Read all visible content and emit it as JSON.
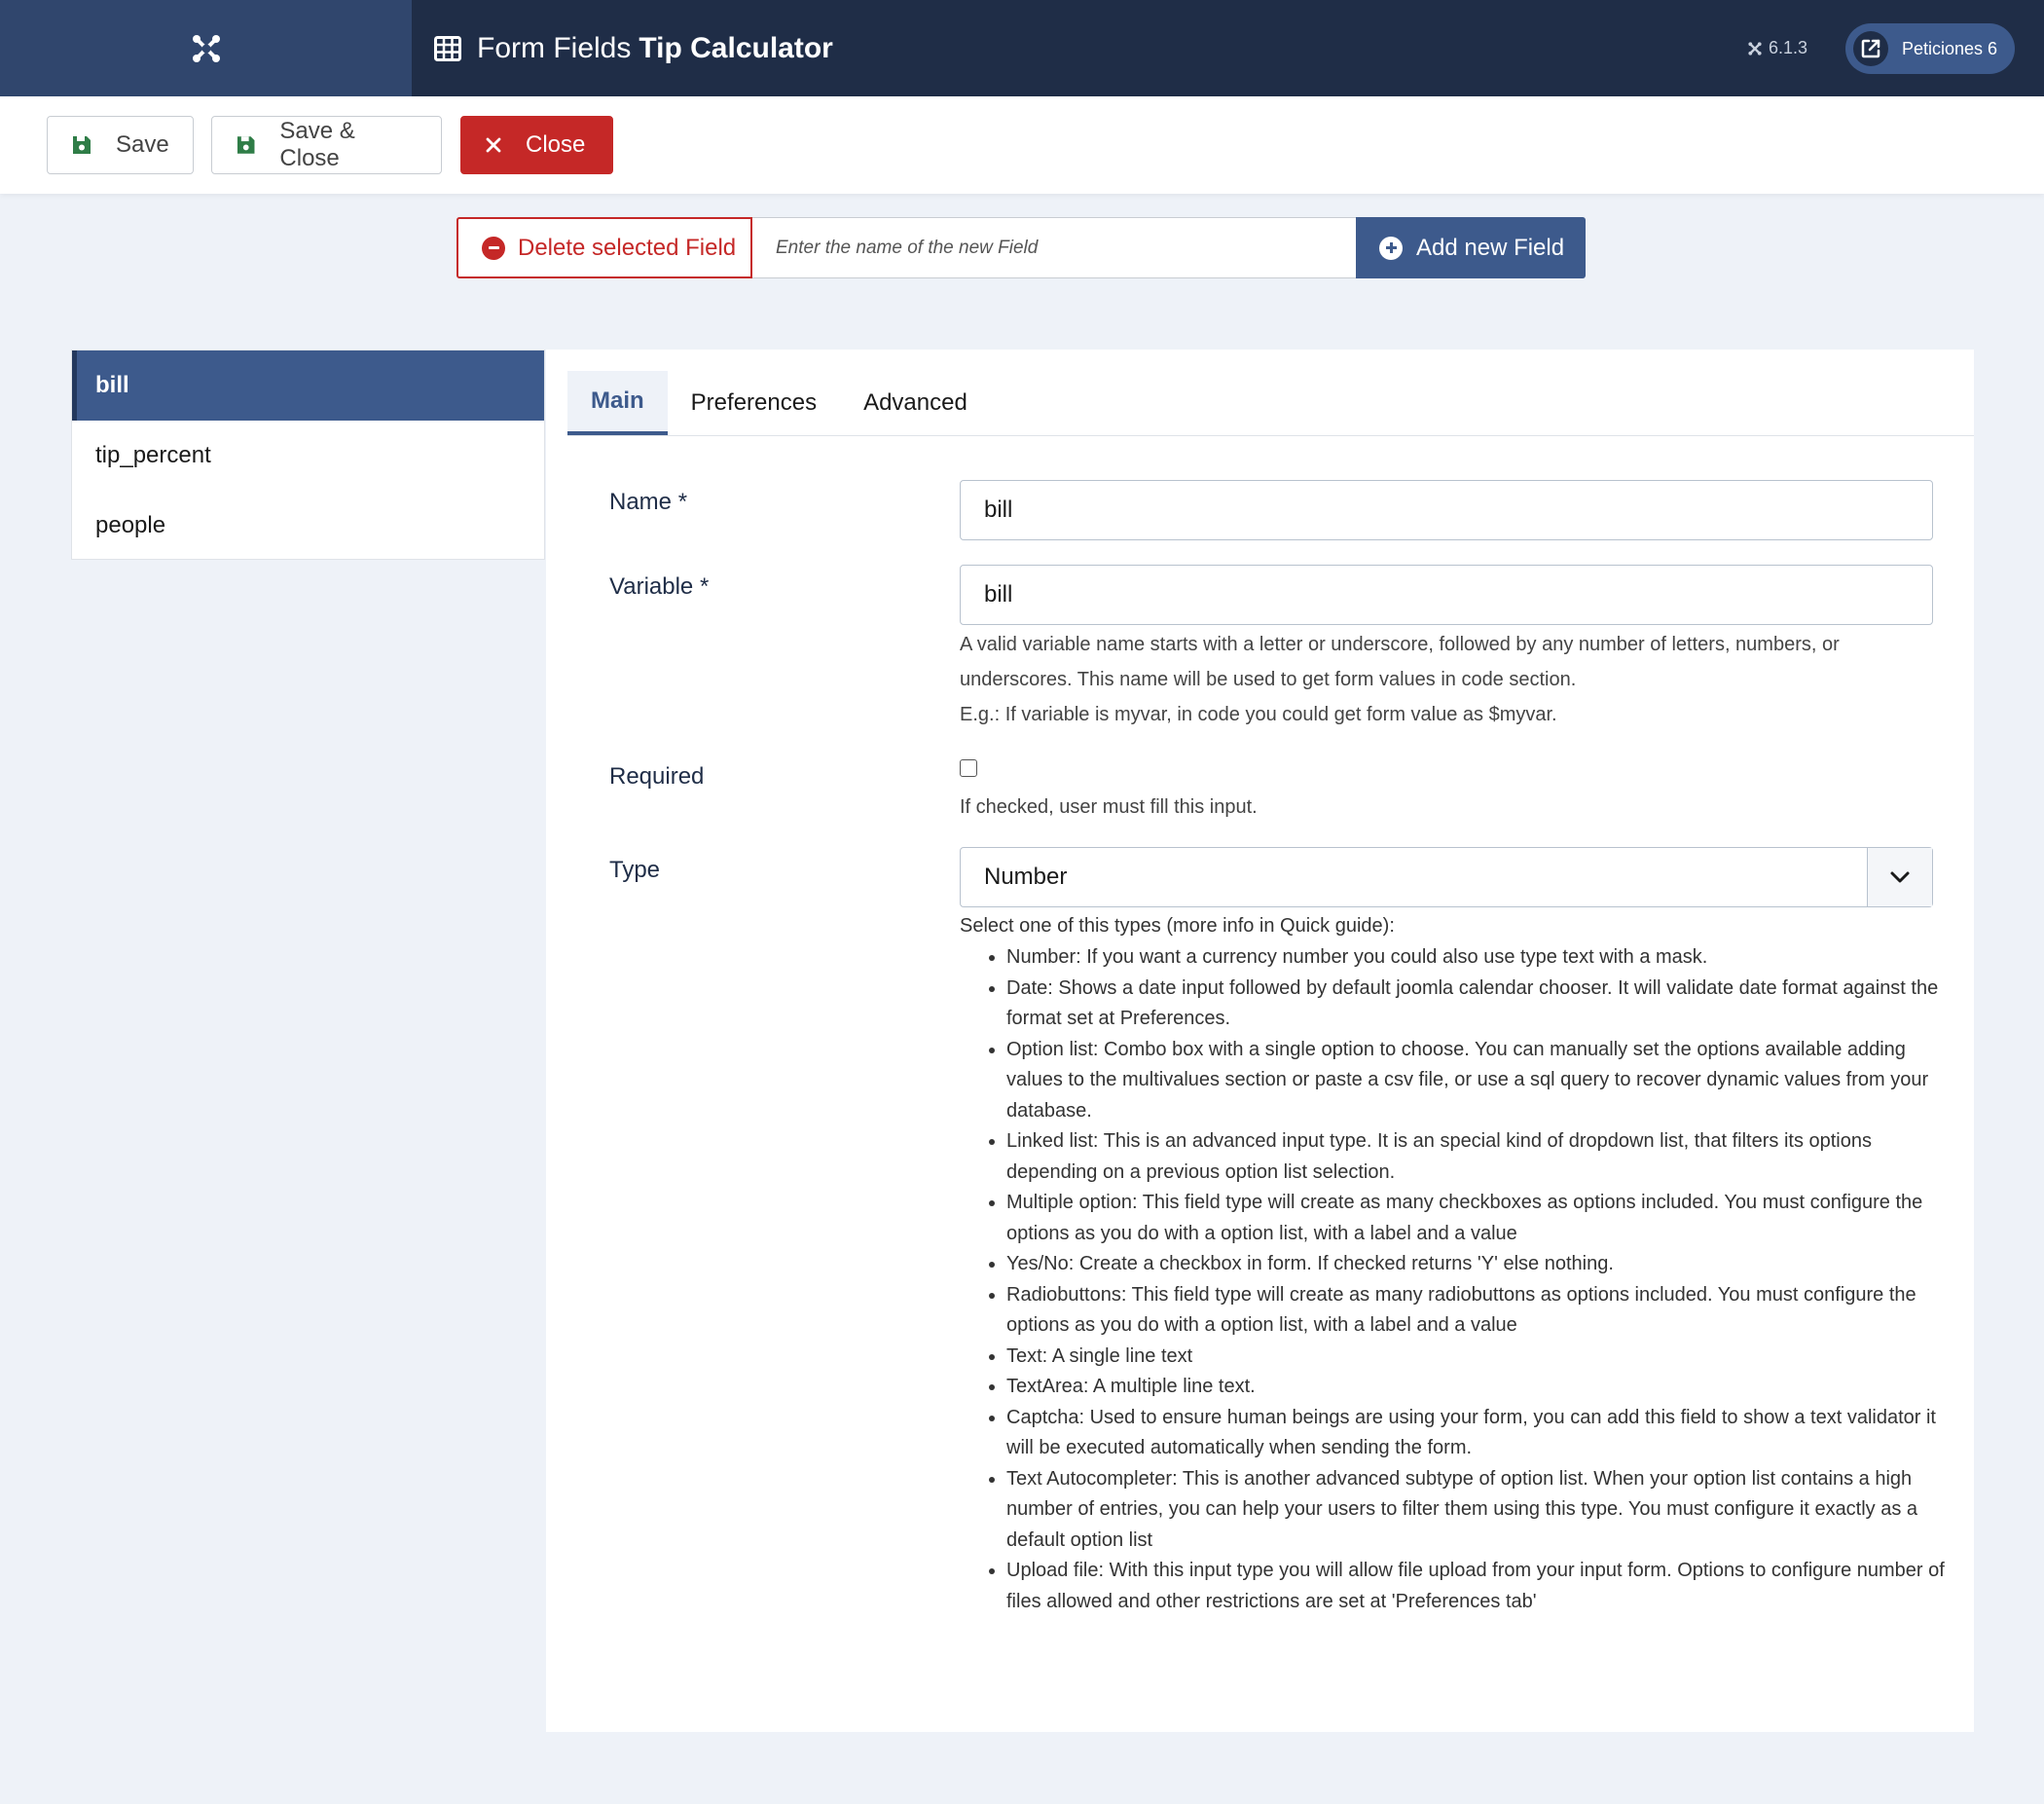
{
  "header": {
    "title_prefix": "Form Fields",
    "title_bold": "Tip Calculator",
    "version": "6.1.3",
    "requests_label": "Peticiones 6",
    "colors": {
      "header_bg": "#1f2d47",
      "logo_bg": "#30466d",
      "accent": "#3d5a8c",
      "danger": "#c52827"
    }
  },
  "toolbar": {
    "save_label": "Save",
    "save_close_label": "Save & Close",
    "close_label": "Close"
  },
  "field_actions": {
    "delete_label": "Delete selected Field",
    "new_field_placeholder": "Enter the name of the new Field",
    "add_label": "Add new Field"
  },
  "fields": [
    {
      "label": "bill",
      "active": true
    },
    {
      "label": "tip_percent",
      "active": false
    },
    {
      "label": "people",
      "active": false
    }
  ],
  "tabs": [
    "Main",
    "Preferences",
    "Advanced"
  ],
  "form": {
    "name_label": "Name *",
    "name_value": "bill",
    "variable_label": "Variable *",
    "variable_value": "bill",
    "variable_help_1": "A valid variable name starts with a letter or underscore, followed by any number of letters, numbers, or underscores. This name will be used to get form values in code section.",
    "variable_help_2": "E.g.: If variable is myvar, in code you could get form value as $myvar.",
    "required_label": "Required",
    "required_checked": false,
    "required_help": "If checked, user must fill this input.",
    "type_label": "Type",
    "type_value": "Number",
    "type_intro": "Select one of this types (more info in Quick guide):",
    "type_items": [
      "Number: If you want a currency number you could also use type text with a mask.",
      "Date: Shows a date input followed by default joomla calendar chooser. It will validate date format against the format set at Preferences.",
      "Option list: Combo box with a single option to choose. You can manually set the options available adding values to the multivalues section or paste a csv file, or use a sql query to recover dynamic values from your database.",
      "Linked list: This is an advanced input type. It is an special kind of dropdown list, that filters its options depending on a previous option list selection.",
      "Multiple option: This field type will create as many checkboxes as options included. You must configure the options as you do with a option list, with a label and a value",
      "Yes/No: Create a checkbox in form. If checked returns 'Y' else nothing.",
      "Radiobuttons: This field type will create as many radiobuttons as options included. You must configure the options as you do with a option list, with a label and a value",
      "Text: A single line text",
      "TextArea: A multiple line text.",
      "Captcha: Used to ensure human beings are using your form, you can add this field to show a text validator it will be executed automatically when sending the form.",
      "Text Autocompleter: This is another advanced subtype of option list. When your option list contains a high number of entries, you can help your users to filter them using this type. You must configure it exactly as a default option list",
      "Upload file: With this input type you will allow file upload from your input form. Options to configure number of files allowed and other restrictions are set at 'Preferences tab'"
    ]
  }
}
